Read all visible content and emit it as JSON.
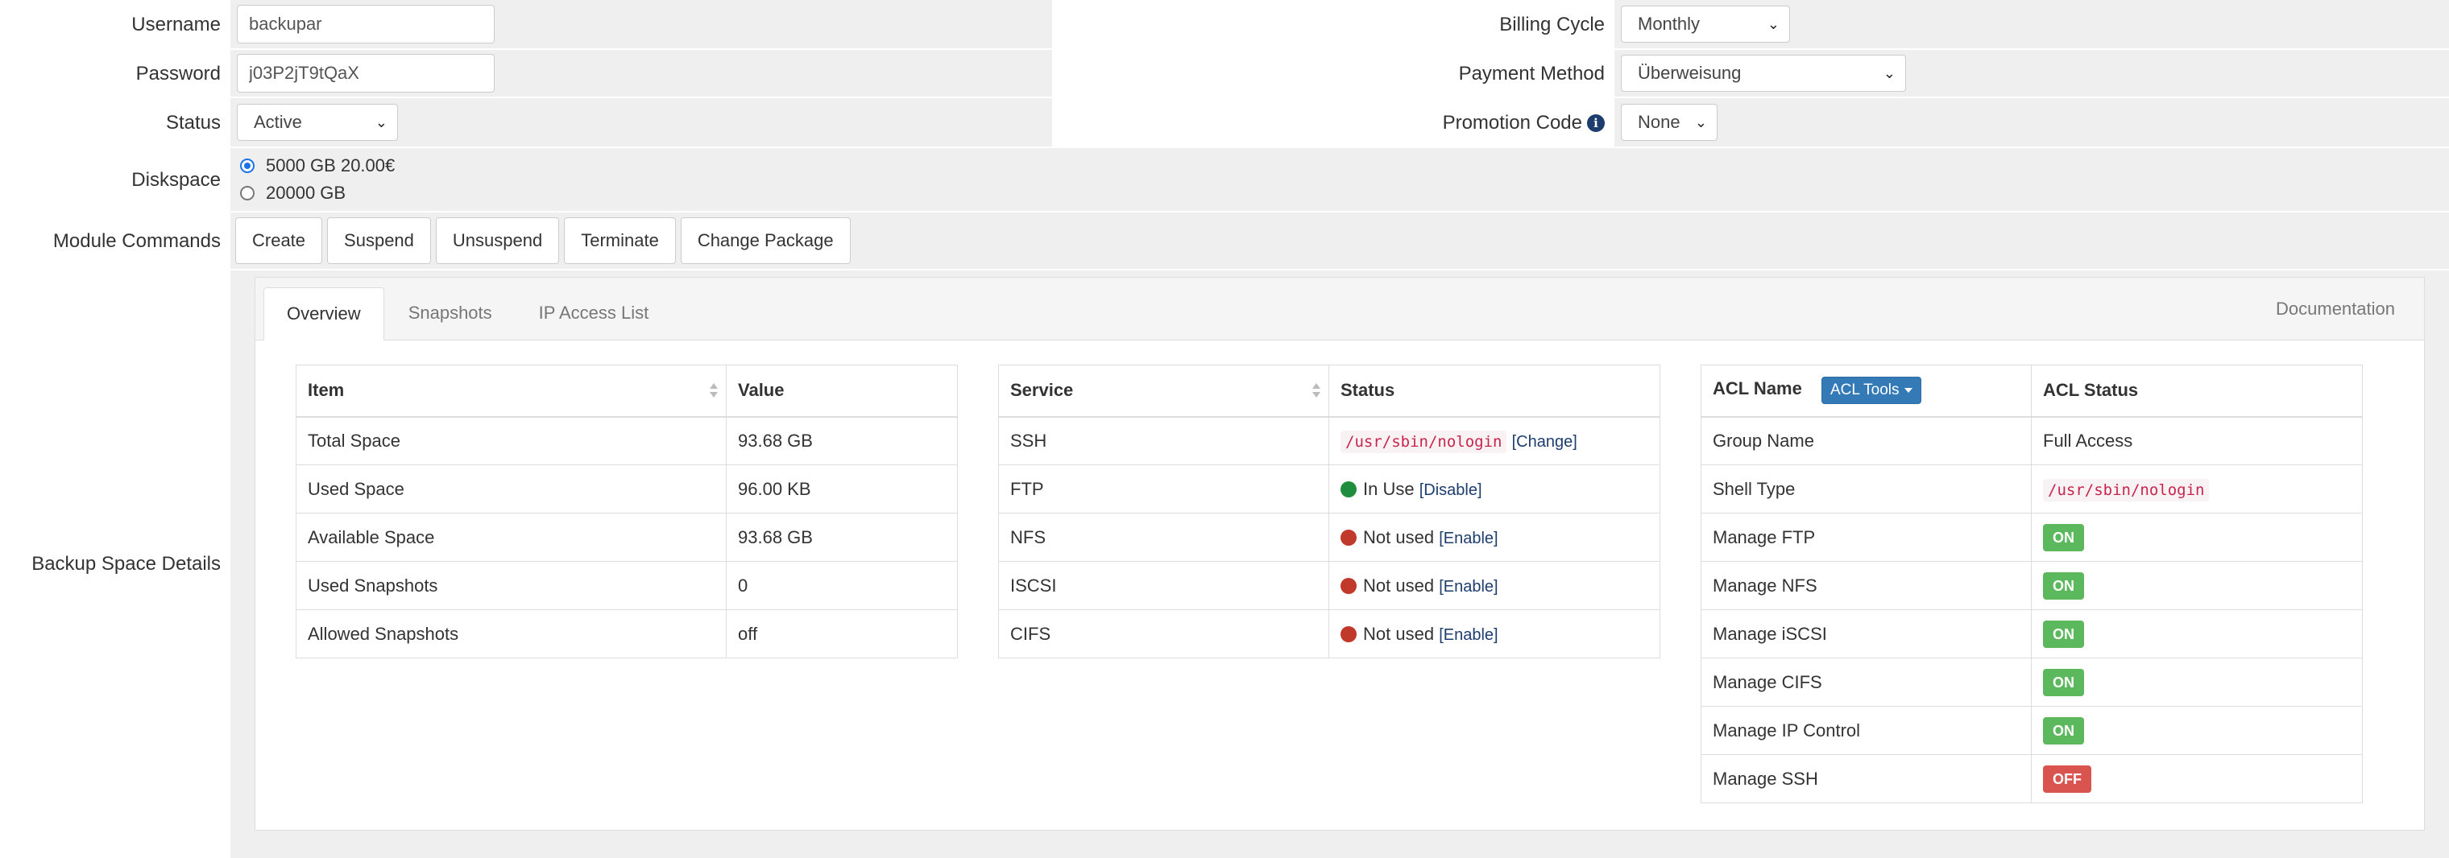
{
  "form": {
    "username": {
      "label": "Username",
      "value": "backupar"
    },
    "password": {
      "label": "Password",
      "value": "j03P2jT9tQaX"
    },
    "status": {
      "label": "Status",
      "value": "Active"
    },
    "billing_cycle": {
      "label": "Billing Cycle",
      "value": "Monthly"
    },
    "payment_method": {
      "label": "Payment Method",
      "value": "Überweisung"
    },
    "promotion_code": {
      "label": "Promotion Code",
      "value": "None"
    },
    "diskspace": {
      "label": "Diskspace",
      "options": [
        {
          "label": "5000 GB 20.00€",
          "checked": true
        },
        {
          "label": "20000 GB",
          "checked": false
        }
      ]
    },
    "module_commands": {
      "label": "Module Commands",
      "buttons": [
        "Create",
        "Suspend",
        "Unsuspend",
        "Terminate",
        "Change Package"
      ]
    },
    "backup_space_details_label": "Backup Space Details"
  },
  "tabs": {
    "items": [
      "Overview",
      "Snapshots",
      "IP Access List"
    ],
    "active": "Overview",
    "documentation": "Documentation"
  },
  "overview_table": {
    "headers": [
      "Item",
      "Value"
    ],
    "rows": [
      [
        "Total Space",
        "93.68 GB"
      ],
      [
        "Used Space",
        "96.00 KB"
      ],
      [
        "Available Space",
        "93.68 GB"
      ],
      [
        "Used Snapshots",
        "0"
      ],
      [
        "Allowed Snapshots",
        "off"
      ]
    ]
  },
  "service_table": {
    "headers": [
      "Service",
      "Status"
    ],
    "rows": [
      {
        "service": "SSH",
        "code": "/usr/sbin/nologin",
        "action": "[Change]"
      },
      {
        "service": "FTP",
        "status": "In Use",
        "state": "green",
        "action": "[Disable]"
      },
      {
        "service": "NFS",
        "status": "Not used",
        "state": "red",
        "action": "[Enable]"
      },
      {
        "service": "ISCSI",
        "status": "Not used",
        "state": "red",
        "action": "[Enable]"
      },
      {
        "service": "CIFS",
        "status": "Not used",
        "state": "red",
        "action": "[Enable]"
      }
    ]
  },
  "acl_table": {
    "headers": [
      "ACL Name",
      "ACL Status"
    ],
    "acl_tools_label": "ACL Tools",
    "group_name": {
      "label": "Group Name",
      "value": "Full Access"
    },
    "shell_type": {
      "label": "Shell Type",
      "value": "/usr/sbin/nologin"
    },
    "rows": [
      {
        "name": "Manage FTP",
        "value": "ON"
      },
      {
        "name": "Manage NFS",
        "value": "ON"
      },
      {
        "name": "Manage iSCSI",
        "value": "ON"
      },
      {
        "name": "Manage CIFS",
        "value": "ON"
      },
      {
        "name": "Manage IP Control",
        "value": "ON"
      },
      {
        "name": "Manage SSH",
        "value": "OFF"
      }
    ]
  },
  "colors": {
    "on": "#5cb85c",
    "off": "#d9534f",
    "in_use": "#1e8e3e",
    "not_used": "#c0392b",
    "acl_tools": "#337ab7",
    "form_bg": "#efefef"
  },
  "icons": {
    "info": "info-circle-icon",
    "sort": "sort-icon",
    "caret": "caret-down-icon",
    "chevron": "chevron-down-icon"
  }
}
